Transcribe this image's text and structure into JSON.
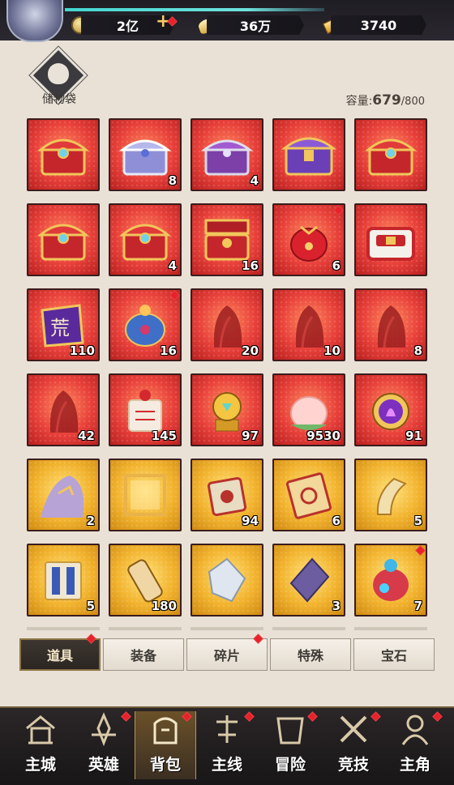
{
  "resources": [
    {
      "icon": "coin-icon",
      "value": "2亿"
    },
    {
      "icon": "gold-ingot-icon",
      "value": "36万"
    },
    {
      "icon": "ticket-icon",
      "value": "3740"
    }
  ],
  "bag": {
    "label": "储物袋",
    "capacity_label": "容量:",
    "capacity_used": "679",
    "capacity_max": "/800"
  },
  "items": [
    {
      "art": "red-gold-chest",
      "bg": "red",
      "count": ""
    },
    {
      "art": "silver-chest",
      "bg": "red",
      "count": "8"
    },
    {
      "art": "purple-chest",
      "bg": "red",
      "count": "4"
    },
    {
      "art": "purple-gold-chest",
      "bg": "red",
      "count": ""
    },
    {
      "art": "red-gold-chest",
      "bg": "red",
      "count": ""
    },
    {
      "art": "red-gold-chest",
      "bg": "red",
      "count": ""
    },
    {
      "art": "red-gold-chest",
      "bg": "red",
      "count": "4"
    },
    {
      "art": "treasure-chest-open",
      "bg": "red",
      "count": "16"
    },
    {
      "art": "red-pouch",
      "bg": "red",
      "count": "6",
      "dot": true
    },
    {
      "art": "red-white-chest",
      "bg": "red",
      "count": ""
    },
    {
      "art": "purple-token",
      "bg": "red",
      "count": "110"
    },
    {
      "art": "blue-pouch",
      "bg": "red",
      "count": "16",
      "dot": true
    },
    {
      "art": "hero-silhouette",
      "bg": "red",
      "count": "20"
    },
    {
      "art": "hero-silhouette",
      "bg": "red",
      "count": "10"
    },
    {
      "art": "hero-silhouette",
      "bg": "red",
      "count": "8"
    },
    {
      "art": "hero-silhouette",
      "bg": "red",
      "count": "42"
    },
    {
      "art": "red-talisman",
      "bg": "red",
      "count": "145"
    },
    {
      "art": "gold-orb",
      "bg": "red",
      "count": "97"
    },
    {
      "art": "peach",
      "bg": "red",
      "count": "9530"
    },
    {
      "art": "purple-flame-amulet",
      "bg": "red",
      "count": "91"
    },
    {
      "art": "dragon-portrait",
      "bg": "gold",
      "count": "2"
    },
    {
      "art": "frame",
      "bg": "gold",
      "count": ""
    },
    {
      "art": "scroll-box",
      "bg": "gold",
      "count": "94"
    },
    {
      "art": "card-ticket",
      "bg": "gold",
      "count": "6"
    },
    {
      "art": "horn",
      "bg": "gold",
      "count": "5"
    },
    {
      "art": "blue-card",
      "bg": "gold",
      "count": "5"
    },
    {
      "art": "scroll",
      "bg": "gold",
      "count": "180"
    },
    {
      "art": "white-crystal",
      "bg": "gold",
      "count": ""
    },
    {
      "art": "purple-crystal",
      "bg": "gold",
      "count": "3"
    },
    {
      "art": "potion-pouch",
      "bg": "gold",
      "count": "7",
      "dot": true
    }
  ],
  "tabs": [
    {
      "label": "道具",
      "active": true,
      "dot": true
    },
    {
      "label": "装备",
      "active": false,
      "dot": false
    },
    {
      "label": "碎片",
      "active": false,
      "dot": true
    },
    {
      "label": "特殊",
      "active": false,
      "dot": false
    },
    {
      "label": "宝石",
      "active": false,
      "dot": false
    }
  ],
  "nav": [
    {
      "label": "主城",
      "icon": "city-icon",
      "active": false,
      "dot": false
    },
    {
      "label": "英雄",
      "icon": "hero-icon",
      "active": false,
      "dot": true
    },
    {
      "label": "背包",
      "icon": "backpack-icon",
      "active": true,
      "dot": true
    },
    {
      "label": "主线",
      "icon": "mainline-icon",
      "active": false,
      "dot": true
    },
    {
      "label": "冒险",
      "icon": "adventure-icon",
      "active": false,
      "dot": true
    },
    {
      "label": "竞技",
      "icon": "arena-icon",
      "active": false,
      "dot": true
    },
    {
      "label": "主角",
      "icon": "protagonist-icon",
      "active": false,
      "dot": true
    }
  ],
  "colors": {
    "accent": "#e8222a",
    "tab_active": "#2b2622",
    "gold": "#f2b32e",
    "red": "#e8403a"
  }
}
